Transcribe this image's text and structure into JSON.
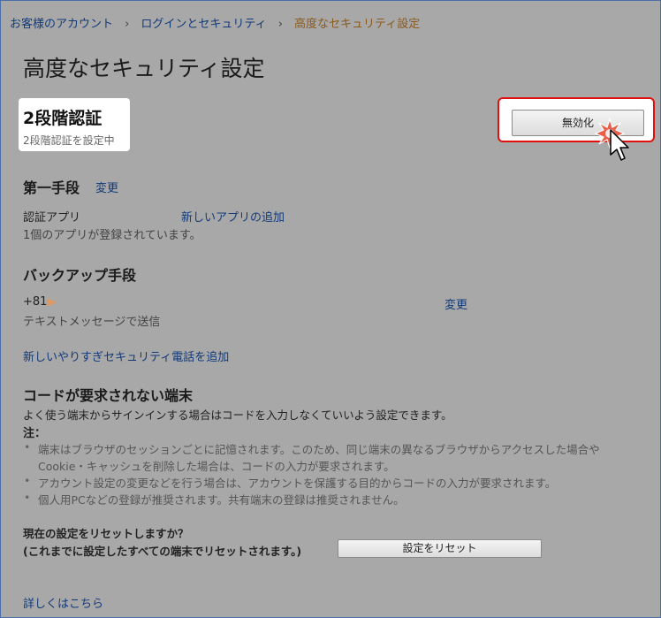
{
  "breadcrumb": {
    "items": [
      "お客様のアカウント",
      "ログインとセキュリティ",
      "高度なセキュリティ設定"
    ],
    "separator": "›"
  },
  "page_title": "高度なセキュリティ設定",
  "two_step": {
    "heading": "2段階認証",
    "status": "2段階認証を設定中",
    "disable_button": "無効化"
  },
  "primary": {
    "heading": "第一手段",
    "change_link": "変更",
    "method_label": "認証アプリ",
    "add_app_link": "新しいアプリの追加",
    "app_count_text": "1個のアプリが登録されています。"
  },
  "backup": {
    "heading": "バックアップ手段",
    "phone_prefix": "+81",
    "change_link": "変更",
    "method_text": "テキストメッセージで送信",
    "add_phone_link": "新しいやりすぎセキュリティ電話を追加"
  },
  "trusted_devices": {
    "heading": "コードが要求されない端末",
    "description": "よく使う端末からサインインする場合はコードを入力しなくていいよう設定できます。",
    "note_label": "注：",
    "notes": [
      "端末はブラウザのセッションごとに記憶されます。このため、同じ端末の異なるブラウザからアクセスした場合や",
      "Cookie・キャッシュを削除した場合は、コードの入力が要求されます。",
      "アカウント設定の変更などを行う場合は、アカウントを保護する目的からコードの入力が要求されます。",
      "個人用PCなどの登録が推奨されます。共有端末の登録は推奨されません。"
    ]
  },
  "reset": {
    "question": "現在の設定をリセットしますか？",
    "explanation": "(これまでに設定したすべての端末でリセットされます。)",
    "button": "設定をリセット"
  },
  "footer": {
    "learn_more_link": "詳しくはこちら"
  },
  "colors": {
    "background": "#a8a8a8",
    "link": "#123a7a",
    "highlight_border": "#e01010",
    "click_burst": "#e8604a"
  },
  "icons": [
    "cursor-arrow-icon",
    "click-burst-icon",
    "redaction-marker-icon"
  ]
}
